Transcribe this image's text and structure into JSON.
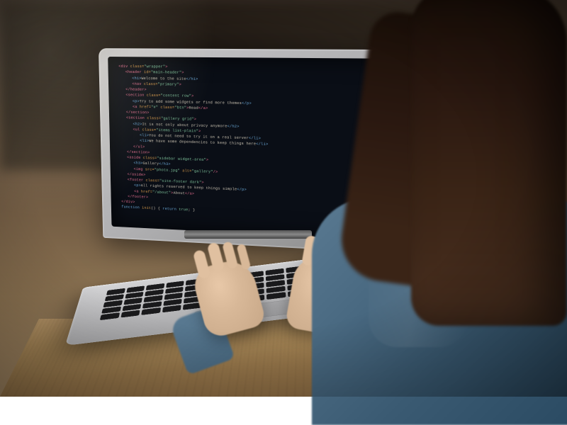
{
  "scene": {
    "description": "Over-the-shoulder photograph of a person typing code on a silver laptop at a wooden desk",
    "subject": "person with long dark hair wearing blue denim shirt",
    "device": "silver laptop (MacBook-style)",
    "screen_content": "code editor with dark theme showing markup/code",
    "setting": "wooden desk, dim warm background"
  },
  "code_colors": {
    "tag": "#e06c8c",
    "attribute": "#d89b4a",
    "string": "#7ec29a",
    "keyword": "#6aa8d8",
    "text": "#c8c0b0",
    "background": "#0a0e16"
  },
  "code_lines": [
    {
      "indent": 0,
      "parts": [
        {
          "c": "tag",
          "t": "<div"
        },
        {
          "c": "attr",
          "t": " class="
        },
        {
          "c": "str",
          "t": "\"wrapper\""
        },
        {
          "c": "tag",
          "t": ">"
        }
      ]
    },
    {
      "indent": 1,
      "parts": [
        {
          "c": "tag",
          "t": "<header"
        },
        {
          "c": "attr",
          "t": " id="
        },
        {
          "c": "str",
          "t": "\"main-header\""
        },
        {
          "c": "tag",
          "t": ">"
        }
      ]
    },
    {
      "indent": 2,
      "parts": [
        {
          "c": "kw",
          "t": "<h1>"
        },
        {
          "c": "txt",
          "t": "Welcome to the site"
        },
        {
          "c": "kw",
          "t": "</h1>"
        }
      ]
    },
    {
      "indent": 2,
      "parts": [
        {
          "c": "tag",
          "t": "<nav"
        },
        {
          "c": "attr",
          "t": " class="
        },
        {
          "c": "str",
          "t": "\"primary\""
        },
        {
          "c": "tag",
          "t": ">"
        }
      ]
    },
    {
      "indent": 1,
      "parts": [
        {
          "c": "tag",
          "t": "</header>"
        }
      ]
    },
    {
      "indent": 1,
      "parts": [
        {
          "c": "tag",
          "t": "<section"
        },
        {
          "c": "attr",
          "t": " class="
        },
        {
          "c": "str",
          "t": "\"content row\""
        },
        {
          "c": "tag",
          "t": ">"
        }
      ]
    },
    {
      "indent": 2,
      "parts": [
        {
          "c": "kw",
          "t": "<p>"
        },
        {
          "c": "txt",
          "t": "Try to add some widgets or find more themes"
        },
        {
          "c": "kw",
          "t": "</p>"
        }
      ]
    },
    {
      "indent": 2,
      "parts": [
        {
          "c": "tag",
          "t": "<a"
        },
        {
          "c": "attr",
          "t": " href="
        },
        {
          "c": "str",
          "t": "\"#\""
        },
        {
          "c": "attr",
          "t": " class="
        },
        {
          "c": "str",
          "t": "\"btn\""
        },
        {
          "c": "tag",
          "t": ">"
        },
        {
          "c": "txt",
          "t": "Read"
        },
        {
          "c": "tag",
          "t": "</a>"
        }
      ]
    },
    {
      "indent": 1,
      "parts": [
        {
          "c": "tag",
          "t": "</section>"
        }
      ]
    },
    {
      "indent": 1,
      "parts": [
        {
          "c": "tag",
          "t": "<section"
        },
        {
          "c": "attr",
          "t": " class="
        },
        {
          "c": "str",
          "t": "\"gallery grid\""
        },
        {
          "c": "tag",
          "t": ">"
        }
      ]
    },
    {
      "indent": 2,
      "parts": [
        {
          "c": "kw",
          "t": "<h2>"
        },
        {
          "c": "txt",
          "t": "It is not only about privacy anymore"
        },
        {
          "c": "kw",
          "t": "</h2>"
        }
      ]
    },
    {
      "indent": 2,
      "parts": [
        {
          "c": "tag",
          "t": "<ul"
        },
        {
          "c": "attr",
          "t": " class="
        },
        {
          "c": "str",
          "t": "\"items list-plain\""
        },
        {
          "c": "tag",
          "t": ">"
        }
      ]
    },
    {
      "indent": 3,
      "parts": [
        {
          "c": "kw",
          "t": "<li>"
        },
        {
          "c": "txt",
          "t": "You do not need to try it on a real server"
        },
        {
          "c": "kw",
          "t": "</li>"
        }
      ]
    },
    {
      "indent": 3,
      "parts": [
        {
          "c": "kw",
          "t": "<li>"
        },
        {
          "c": "txt",
          "t": "We have some dependencies to keep things here"
        },
        {
          "c": "kw",
          "t": "</li>"
        }
      ]
    },
    {
      "indent": 2,
      "parts": [
        {
          "c": "tag",
          "t": "</ul>"
        }
      ]
    },
    {
      "indent": 1,
      "parts": [
        {
          "c": "tag",
          "t": "</section>"
        }
      ]
    },
    {
      "indent": 1,
      "parts": [
        {
          "c": "tag",
          "t": "<aside"
        },
        {
          "c": "attr",
          "t": " class="
        },
        {
          "c": "str",
          "t": "\"sidebar widget-area\""
        },
        {
          "c": "tag",
          "t": ">"
        }
      ]
    },
    {
      "indent": 2,
      "parts": [
        {
          "c": "kw",
          "t": "<h3>"
        },
        {
          "c": "txt",
          "t": "Gallery"
        },
        {
          "c": "kw",
          "t": "</h3>"
        }
      ]
    },
    {
      "indent": 2,
      "parts": [
        {
          "c": "tag",
          "t": "<img"
        },
        {
          "c": "attr",
          "t": " src="
        },
        {
          "c": "str",
          "t": "\"photo.jpg\""
        },
        {
          "c": "attr",
          "t": " alt="
        },
        {
          "c": "str",
          "t": "\"gallery\""
        },
        {
          "c": "tag",
          "t": "/>"
        }
      ]
    },
    {
      "indent": 1,
      "parts": [
        {
          "c": "tag",
          "t": "</aside>"
        }
      ]
    },
    {
      "indent": 1,
      "parts": [
        {
          "c": "tag",
          "t": "<footer"
        },
        {
          "c": "attr",
          "t": " class="
        },
        {
          "c": "str",
          "t": "\"site-footer dark\""
        },
        {
          "c": "tag",
          "t": ">"
        }
      ]
    },
    {
      "indent": 2,
      "parts": [
        {
          "c": "kw",
          "t": "<p>"
        },
        {
          "c": "txt",
          "t": "All rights reserved to keep things simple"
        },
        {
          "c": "kw",
          "t": "</p>"
        }
      ]
    },
    {
      "indent": 2,
      "parts": [
        {
          "c": "tag",
          "t": "<a"
        },
        {
          "c": "attr",
          "t": " href="
        },
        {
          "c": "str",
          "t": "\"/about\""
        },
        {
          "c": "tag",
          "t": ">"
        },
        {
          "c": "txt",
          "t": "About"
        },
        {
          "c": "tag",
          "t": "</a>"
        }
      ]
    },
    {
      "indent": 1,
      "parts": [
        {
          "c": "tag",
          "t": "</footer>"
        }
      ]
    },
    {
      "indent": 0,
      "parts": [
        {
          "c": "tag",
          "t": "</div>"
        }
      ]
    },
    {
      "indent": 0,
      "parts": [
        {
          "c": "kw",
          "t": "function"
        },
        {
          "c": "txt",
          "t": " "
        },
        {
          "c": "attr",
          "t": "init"
        },
        {
          "c": "txt",
          "t": "() { "
        },
        {
          "c": "kw",
          "t": "return"
        },
        {
          "c": "txt",
          "t": " "
        },
        {
          "c": "str",
          "t": "true"
        },
        {
          "c": "txt",
          "t": "; }"
        }
      ]
    }
  ]
}
